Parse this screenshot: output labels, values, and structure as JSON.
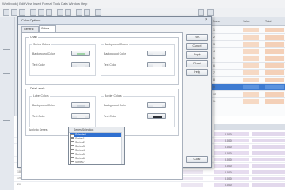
{
  "app": {
    "menu_text": "Workbook  |  Edit  View  Insert  Format  Tools  Data  Window  Help"
  },
  "dialog": {
    "title": "Color Options",
    "close_glyph": "×",
    "tabs": [
      {
        "label": "General"
      },
      {
        "label": "Colors"
      }
    ],
    "groups": {
      "top": {
        "label": "Chart",
        "left_sub": {
          "label": "Series Colors",
          "row1": "Background Color",
          "row2": "Text Color"
        },
        "right_sub": {
          "label": "Background Colors",
          "row1": "Background Color",
          "row2": "Text Color"
        }
      },
      "middle": {
        "label": "Data Labels",
        "left_sub": {
          "label": "Label Colors",
          "row1": "Background Color",
          "row2": "Text Color"
        },
        "right_sub": {
          "label": "Border Colors",
          "row1": "Background Color",
          "row2": "Text Color"
        }
      },
      "bottom": {
        "label": "Apply to Series"
      }
    },
    "swatches": {
      "top_left_1": "#9fd2a6",
      "top_left_2": "#e9ecef",
      "top_right_1": "#eef0f2",
      "top_right_2": "#f3f4f6",
      "mid_left_1": "#c9d0d8",
      "mid_left_2": "#f1f2f4",
      "mid_right_1": "#f2f3f5",
      "mid_right_2": "#2b2f35"
    },
    "list": {
      "header": "Series Selection",
      "items": [
        "Selected",
        "Series1",
        "Series2",
        "Series3",
        "Series4",
        "Series5",
        "Series6",
        "Series7",
        "Series8",
        "Series9"
      ]
    },
    "buttons": [
      "OK",
      "Cancel",
      "Apply",
      "Reset",
      "Help"
    ],
    "bottom_button": "Close"
  },
  "right_grid": {
    "headers": [
      "Name",
      "Value",
      "Total"
    ],
    "rows": [
      "1",
      "2",
      "3",
      "4",
      "5",
      "6",
      "7",
      "8",
      "9",
      "10",
      "11"
    ]
  },
  "bottom_grid": {
    "rows": [
      "12",
      "13",
      "14",
      "15",
      "16",
      "17",
      "18",
      "19",
      "20",
      "21",
      "22"
    ],
    "values": [
      "0.000",
      "0.000",
      "0.000",
      "0.000",
      "0.000",
      "0.000",
      "0.000",
      "0.000",
      "0.000",
      "0.000",
      "0.000"
    ]
  },
  "colors": {
    "selection": "#2f6fd0",
    "accent_cells": "#f4d0b8",
    "purple_cells": "#e6dcef"
  }
}
